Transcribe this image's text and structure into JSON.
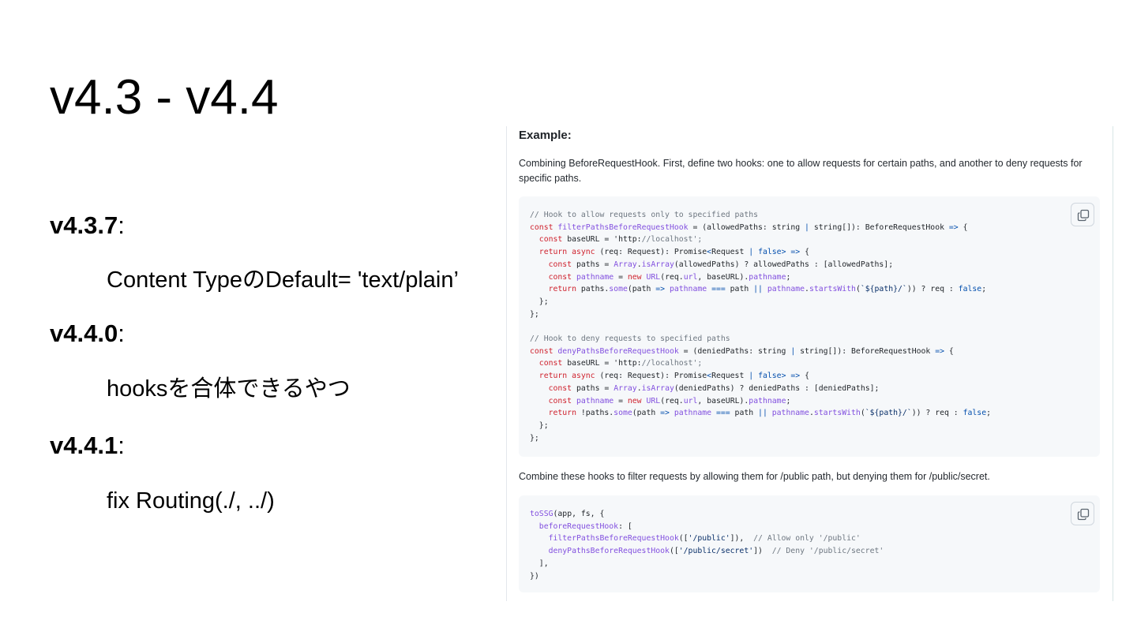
{
  "slide": {
    "title": "v4.3 - v4.4",
    "entries": [
      {
        "version": "v4.3.7",
        "colon": ":",
        "note": "Content TypeのDefault= 'text/plain’"
      },
      {
        "version": "v4.4.0",
        "colon": ":",
        "note": "hooksを合体できるやつ"
      },
      {
        "version": "v4.4.1",
        "colon": ":",
        "note": "fix Routing(./, ../)"
      }
    ]
  },
  "panel": {
    "heading": "Example:",
    "intro": "Combining BeforeRequestHook. First, define two hooks: one to allow requests for certain paths, and another to deny requests for specific paths.",
    "middle": "Combine these hooks to filter requests by allowing them for /public path, but denying them for /public/secret.",
    "copy_icon": "copy-icon",
    "code1": [
      "// Hook to allow requests only to specified paths",
      "const filterPathsBeforeRequestHook = (allowedPaths: string | string[]): BeforeRequestHook => {",
      "  const baseURL = 'http://localhost';",
      "  return async (req: Request): Promise<Request | false> => {",
      "    const paths = Array.isArray(allowedPaths) ? allowedPaths : [allowedPaths];",
      "    const pathname = new URL(req.url, baseURL).pathname;",
      "    return paths.some(path => pathname === path || pathname.startsWith(`${path}/`)) ? req : false;",
      "  };",
      "};",
      "",
      "// Hook to deny requests to specified paths",
      "const denyPathsBeforeRequestHook = (deniedPaths: string | string[]): BeforeRequestHook => {",
      "  const baseURL = 'http://localhost';",
      "  return async (req: Request): Promise<Request | false> => {",
      "    const paths = Array.isArray(deniedPaths) ? deniedPaths : [deniedPaths];",
      "    const pathname = new URL(req.url, baseURL).pathname;",
      "    return !paths.some(path => pathname === path || pathname.startsWith(`${path}/`)) ? req : false;",
      "  };",
      "};"
    ],
    "code2": [
      "toSSG(app, fs, {",
      "  beforeRequestHook: [",
      "    filterPathsBeforeRequestHook(['/public']),  // Allow only '/public'",
      "    denyPathsBeforeRequestHook(['/public/secret'])  // Deny '/public/secret'",
      "  ],",
      "})"
    ]
  },
  "colors": {
    "code_bg": "#f6f8fa",
    "keyword": "#cf222e",
    "function": "#8250df",
    "string": "#0a3069",
    "constant": "#0550ae",
    "comment": "#6e7781"
  }
}
